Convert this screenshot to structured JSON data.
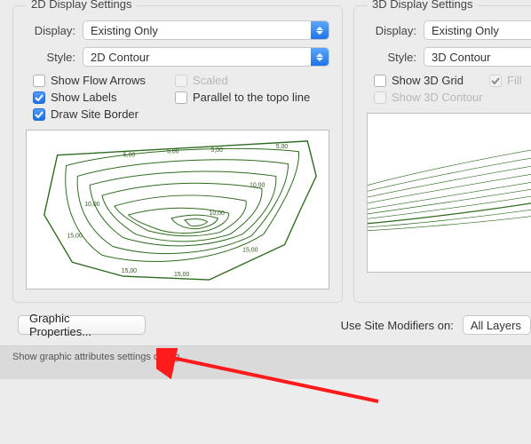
{
  "panel2d": {
    "title": "2D Display Settings",
    "display_label": "Display:",
    "display_value": "Existing Only",
    "style_label": "Style:",
    "style_value": "2D Contour",
    "checks": {
      "flow_arrows": "Show Flow Arrows",
      "scaled": "Scaled",
      "show_labels": "Show Labels",
      "parallel": "Parallel to the topo line",
      "draw_border": "Draw Site Border"
    },
    "contour_labels": [
      "5,00",
      "5,00",
      "5,00",
      "5,00",
      "10,00",
      "15,00",
      "15,00",
      "15,00",
      "10,00",
      "10,00",
      "15,00"
    ]
  },
  "panel3d": {
    "title": "3D Display Settings",
    "display_label": "Display:",
    "display_value": "Existing Only",
    "style_label": "Style:",
    "style_value": "3D Contour",
    "checks": {
      "show_grid": "Show 3D Grid",
      "fill": "Fill",
      "show_contour": "Show 3D Contour"
    }
  },
  "buttons": {
    "graphic_properties": "Graphic Properties..."
  },
  "use_modifiers_label": "Use Site Modifiers on:",
  "use_modifiers_value": "All Layers",
  "statusbar": "Show graphic attributes settings dialog.",
  "colors": {
    "accent": "#2a78e4",
    "contour": "#2e6b1f"
  }
}
